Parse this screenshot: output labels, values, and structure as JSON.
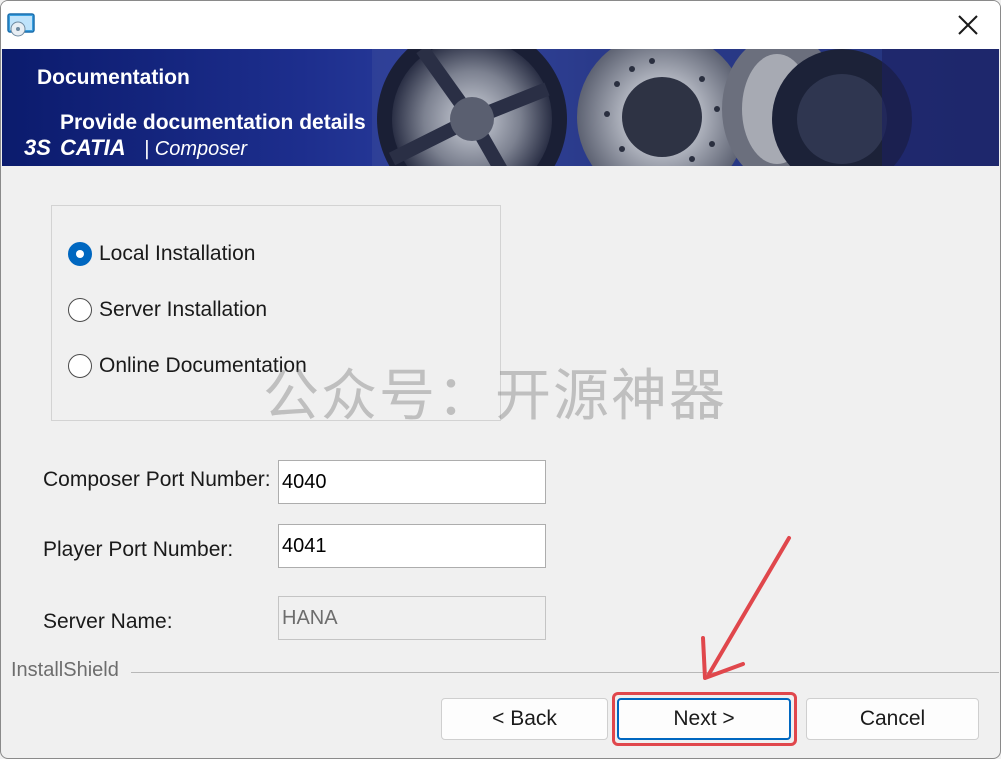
{
  "window": {
    "app_icon": "installer-disc-icon",
    "close_icon": "close-icon"
  },
  "banner": {
    "title": "Documentation",
    "subtitle": "Provide documentation details",
    "logo_text": "CATIA | Composer",
    "colors": {
      "background": "#1d2e8d",
      "text": "#ffffff"
    }
  },
  "install_type": {
    "options": [
      {
        "label": "Local Installation",
        "checked": true
      },
      {
        "label": "Server Installation",
        "checked": false
      },
      {
        "label": "Online Documentation",
        "checked": false
      }
    ]
  },
  "fields": {
    "composer_port": {
      "label": "Composer Port Number:",
      "value": "4040"
    },
    "player_port": {
      "label": "Player Port Number:",
      "value": "4041"
    },
    "server_name": {
      "label": "Server Name:",
      "value": "HANA",
      "disabled": true
    }
  },
  "footer": {
    "brand": "InstallShield",
    "back_label": "< Back",
    "next_label": "Next >",
    "cancel_label": "Cancel"
  },
  "watermark": "公众号：开源神器",
  "colors": {
    "accent": "#0067c0",
    "annotation": "#e0474c"
  }
}
